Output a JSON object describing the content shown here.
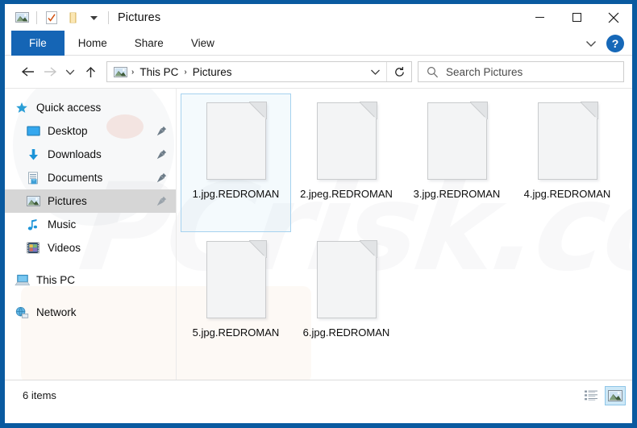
{
  "window": {
    "title": "Pictures",
    "accent_color": "#0a5aa0",
    "file_tab_color": "#1565b5",
    "quick_access_toolbar": [
      {
        "name": "pictures-library-icon",
        "label": "Pictures library"
      },
      {
        "name": "properties-icon",
        "label": "Properties"
      },
      {
        "name": "new-folder-icon",
        "label": "New folder"
      },
      {
        "name": "customize-qat-dropdown-icon",
        "label": "Customize Quick Access Toolbar"
      }
    ],
    "controls": {
      "minimize": "—",
      "maximize": "□",
      "close": "✕"
    }
  },
  "ribbon": {
    "tabs": [
      {
        "label": "File",
        "selected": true
      },
      {
        "label": "Home",
        "selected": false
      },
      {
        "label": "Share",
        "selected": false
      },
      {
        "label": "View",
        "selected": false
      }
    ],
    "expand_ribbon_label": "⌄",
    "help_label": "?"
  },
  "address": {
    "back_label": "←",
    "forward_label": "→",
    "recent_label": "⌄",
    "up_label": "↑",
    "breadcrumb_icon": "pictures-icon",
    "breadcrumbs": [
      "This PC",
      "Pictures"
    ],
    "separator": "›",
    "dropdown_label": "⌄",
    "refresh_label": "↻"
  },
  "search": {
    "placeholder": "Search Pictures",
    "value": "",
    "icon": "search-icon"
  },
  "sidebar": {
    "items": [
      {
        "label": "Quick access",
        "icon": "star-icon",
        "pinned": false,
        "selected": false,
        "root": true
      },
      {
        "label": "Desktop",
        "icon": "desktop-icon",
        "pinned": true,
        "selected": false,
        "root": false
      },
      {
        "label": "Downloads",
        "icon": "downloads-icon",
        "pinned": true,
        "selected": false,
        "root": false
      },
      {
        "label": "Documents",
        "icon": "documents-icon",
        "pinned": true,
        "selected": false,
        "root": false
      },
      {
        "label": "Pictures",
        "icon": "pictures-icon",
        "pinned": true,
        "selected": true,
        "root": false
      },
      {
        "label": "Music",
        "icon": "music-icon",
        "pinned": false,
        "selected": false,
        "root": false
      },
      {
        "label": "Videos",
        "icon": "videos-icon",
        "pinned": false,
        "selected": false,
        "root": false
      },
      {
        "label": "This PC",
        "icon": "this-pc-icon",
        "pinned": false,
        "selected": false,
        "root": true,
        "gap_before": true
      },
      {
        "label": "Network",
        "icon": "network-icon",
        "pinned": false,
        "selected": false,
        "root": true,
        "gap_before": true
      }
    ]
  },
  "files": [
    {
      "name": "1.jpg.REDROMAN",
      "icon": "encrypted-file-icon",
      "selected": true
    },
    {
      "name": "2.jpeg.REDROMAN",
      "icon": "encrypted-file-icon",
      "selected": false
    },
    {
      "name": "3.jpg.REDROMAN",
      "icon": "encrypted-file-icon",
      "selected": false
    },
    {
      "name": "4.jpg.REDROMAN",
      "icon": "encrypted-file-icon",
      "selected": false
    },
    {
      "name": "5.jpg.REDROMAN",
      "icon": "encrypted-file-icon",
      "selected": false
    },
    {
      "name": "6.jpg.REDROMAN",
      "icon": "encrypted-file-icon",
      "selected": false
    }
  ],
  "statusbar": {
    "item_count": "6 items",
    "views": [
      {
        "name": "details-view-button",
        "label": "Details view",
        "active": false
      },
      {
        "name": "large-icons-view-button",
        "label": "Large icons view",
        "active": true
      }
    ]
  },
  "watermark": {
    "text": "PCrisk.com"
  }
}
